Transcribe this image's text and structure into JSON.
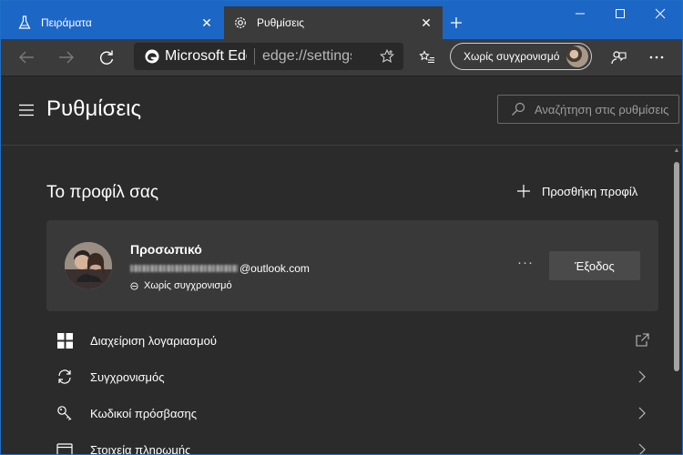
{
  "tabs": [
    {
      "label": "Πειράματα",
      "icon": "flask-icon"
    },
    {
      "label": "Ρυθμίσεις",
      "icon": "gear-icon"
    }
  ],
  "toolbar": {
    "site_name": "Microsoft Edge",
    "url": "edge://settings",
    "sync_label": "Χωρίς συγχρονισμό"
  },
  "settings": {
    "title": "Ρυθμίσεις",
    "search_placeholder": "Αναζήτηση στις ρυθμίσεις"
  },
  "profile_section": {
    "title": "Το προφίλ σας",
    "add_profile": "Προσθήκη προφίλ",
    "profile_name": "Προσωπικό",
    "email_suffix": "@outlook.com",
    "sync_status": "Χωρίς συγχρονισμό",
    "logout": "Έξοδος",
    "more": "···"
  },
  "menu_items": [
    {
      "label": "Διαχείριση λογαριασμού",
      "icon": "windows-grid-icon",
      "end_icon": "external-link-icon"
    },
    {
      "label": "Συγχρονισμός",
      "icon": "sync-icon",
      "end_icon": "chevron-right-icon"
    },
    {
      "label": "Κωδικοί πρόσβασης",
      "icon": "key-icon",
      "end_icon": "chevron-right-icon"
    },
    {
      "label": "Στοιχεία πληρωμής",
      "icon": "credit-card-icon",
      "end_icon": "chevron-right-icon"
    }
  ],
  "colors": {
    "titlebar": "#1c66c6",
    "toolbar": "#3b3b3b",
    "page_bg": "#2b2b2b",
    "card_bg": "#393939"
  }
}
